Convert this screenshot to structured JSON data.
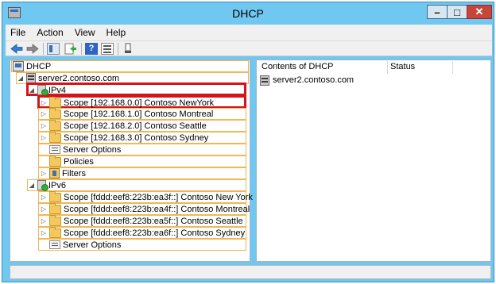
{
  "window": {
    "title": "DHCP",
    "controls": {
      "minimize": "–",
      "maximize": "□",
      "close": "✕"
    }
  },
  "menu": [
    "File",
    "Action",
    "View",
    "Help"
  ],
  "toolbar": {
    "back": "back-arrow",
    "forward": "forward-arrow",
    "show_tree": "console-tree-icon",
    "export": "export-list-icon",
    "help": "?",
    "properties": "properties-icon",
    "mmc": "mmc-icon"
  },
  "tree": {
    "root": "DHCP",
    "server": "server2.contoso.com",
    "ipv4": {
      "label": "IPv4",
      "children": [
        "Scope [192.168.0.0] Contoso NewYork",
        "Scope [192.168.1.0] Contoso Montreal",
        "Scope [192.168.2.0] Contoso Seattle",
        "Scope [192.168.3.0] Contoso Sydney",
        "Server Options",
        "Policies",
        "Filters"
      ]
    },
    "ipv6": {
      "label": "IPv6",
      "children": [
        "Scope [fddd:eef8:223b:ea3f::] Contoso New York",
        "Scope [fddd:eef8:223b:ea4f::] Contoso Montreal",
        "Scope [fddd:eef8:223b:ea5f::] Contoso Seattle",
        "Scope [fddd:eef8:223b:ea6f::] Contoso Sydney",
        "Server Options"
      ]
    }
  },
  "list": {
    "columns": [
      "Contents of DHCP",
      "Status"
    ],
    "rows": [
      "server2.contoso.com"
    ]
  },
  "colors": {
    "frame": "#70c7f0",
    "highlight_border": "#f0b657",
    "callout_red": "#d3141a"
  }
}
